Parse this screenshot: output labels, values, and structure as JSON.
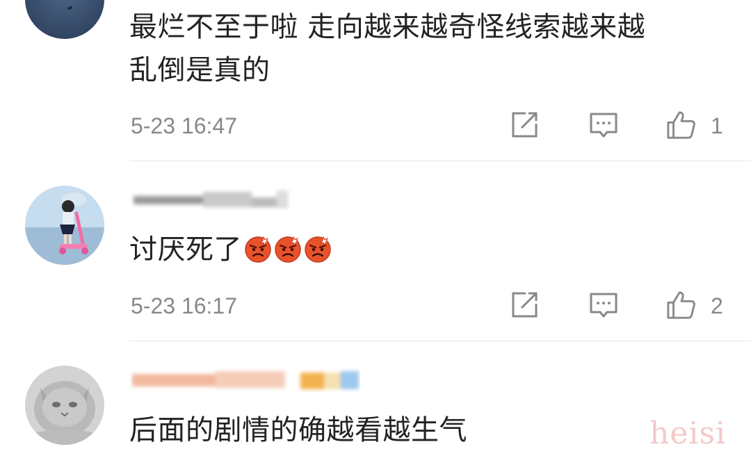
{
  "comments": [
    {
      "username": "",
      "text_line1": "最烂不至于啦 走向越来越奇怪线索越来越",
      "text_line2": "乱倒是真的",
      "time": "5-23 16:47",
      "like_count": "1"
    },
    {
      "username": "",
      "text": "讨厌死了",
      "emoji": [
        "angry-face-icon",
        "angry-face-icon",
        "angry-face-icon"
      ],
      "time": "5-23 16:17",
      "like_count": "2"
    },
    {
      "username": "",
      "text": "后面的剧情的确越看越生气"
    }
  ],
  "icons": {
    "share": "share-icon",
    "reply": "reply-icon",
    "like": "thumbs-up-icon"
  },
  "colors": {
    "text": "#222222",
    "meta": "#888888",
    "divider": "#e6e6e6",
    "emoji": "#e8532b",
    "watermark": "#f3c9c9"
  },
  "watermark": "heisi"
}
